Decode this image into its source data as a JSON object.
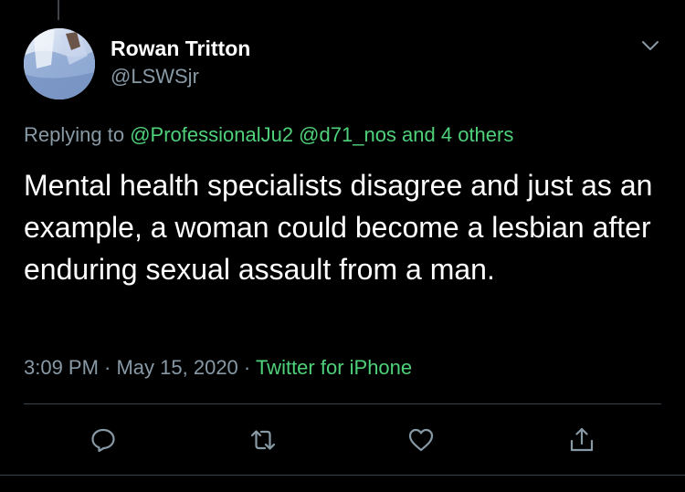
{
  "tweet": {
    "author": {
      "name": "Rowan Tritton",
      "handle": "@LSWSjr"
    },
    "replying": {
      "prefix": "Replying to",
      "mentions": "@ProfessionalJu2 @d71_nos and 4 others"
    },
    "text": "Mental health specialists disagree and just as an example, a woman could become a lesbian after enduring sexual assault from a man.",
    "meta": {
      "time_date": "3:09 PM · May 15, 2020 · ",
      "source": "Twitter for iPhone"
    }
  },
  "icons": {
    "more": "chevron-down-icon",
    "reply": "reply-icon",
    "retweet": "retweet-icon",
    "like": "heart-icon",
    "share": "share-icon"
  },
  "colors": {
    "background": "#000000",
    "primary_text": "#ffffff",
    "secondary_text": "#8899a6",
    "link": "#4fd07a",
    "divider": "#38444d"
  }
}
